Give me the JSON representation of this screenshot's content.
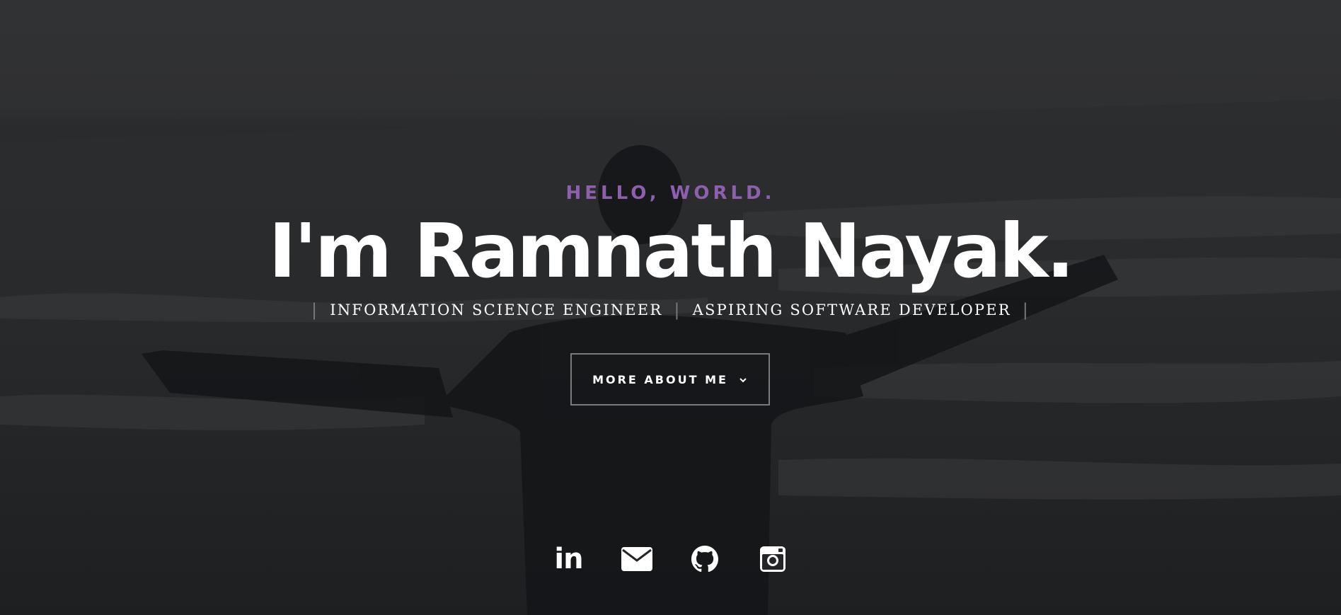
{
  "hero": {
    "greeting": "HELLO, WORLD.",
    "headline": "I'm Ramnath Nayak.",
    "roles": [
      "INFORMATION SCIENCE ENGINEER",
      "ASPIRING SOFTWARE DEVELOPER"
    ],
    "role_separator": "|",
    "cta_label": "MORE ABOUT ME",
    "cta_icon": "chevron-down-icon",
    "accent_color": "#8e5fad"
  },
  "socials": [
    {
      "name": "linkedin",
      "icon": "linkedin-icon",
      "glyph": "in"
    },
    {
      "name": "email",
      "icon": "envelope-icon"
    },
    {
      "name": "github",
      "icon": "github-icon"
    },
    {
      "name": "instagram",
      "icon": "instagram-icon"
    }
  ]
}
